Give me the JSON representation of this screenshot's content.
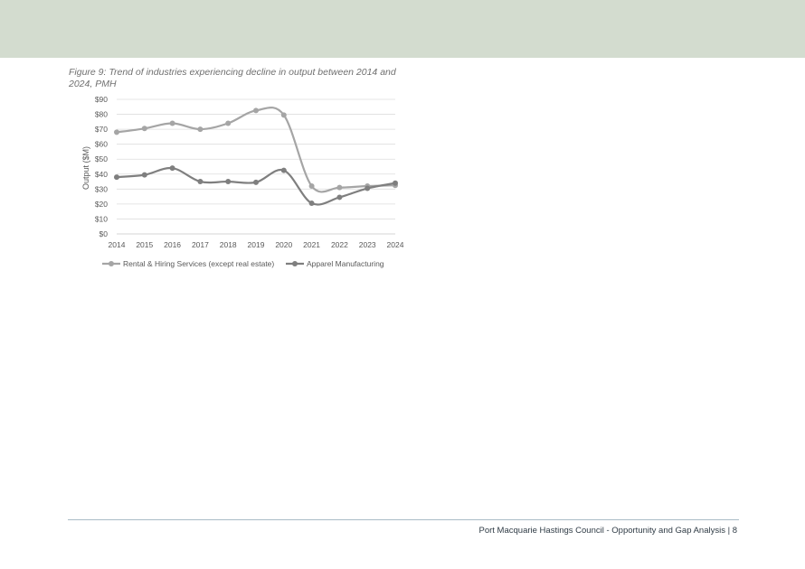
{
  "page": {
    "caption": "Figure 9: Trend of industries experiencing decline in output between 2014 and 2024, PMH",
    "footer": "Port Macquarie Hastings Council - Opportunity and Gap Analysis | 8",
    "header_color": "#d3dccf"
  },
  "chart_data": {
    "type": "line",
    "title": "",
    "xlabel": "",
    "ylabel": "Output ($M)",
    "x": [
      "2014",
      "2015",
      "2016",
      "2017",
      "2018",
      "2019",
      "2020",
      "2021",
      "2022",
      "2023",
      "2024"
    ],
    "ylim": [
      0,
      90
    ],
    "yticks": [
      0,
      10,
      20,
      30,
      40,
      50,
      60,
      70,
      80,
      90
    ],
    "ytick_labels": [
      "$0",
      "$10",
      "$20",
      "$30",
      "$40",
      "$50",
      "$60",
      "$70",
      "$80",
      "$90"
    ],
    "grid": true,
    "smooth": true,
    "legend_position": "bottom",
    "series": [
      {
        "name": "Rental & Hiring Services (except real estate)",
        "color": "#a5a5a5",
        "values": [
          68,
          70.5,
          74,
          70,
          74,
          82.5,
          79.5,
          32,
          31,
          32,
          32.5
        ]
      },
      {
        "name": "Apparel Manufacturing",
        "color": "#7f7f7f",
        "values": [
          38,
          39.5,
          44,
          35,
          35,
          34.5,
          42.5,
          20.5,
          24.5,
          30.5,
          34
        ]
      }
    ]
  }
}
